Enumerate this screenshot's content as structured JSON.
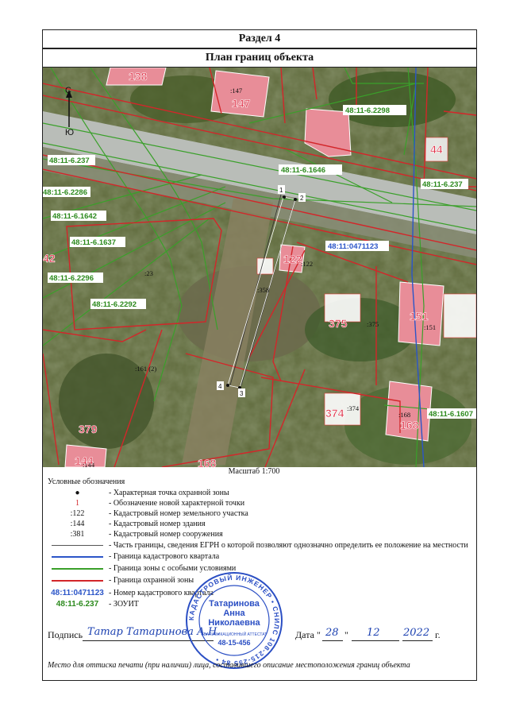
{
  "header": {
    "section": "Раздел 4",
    "title": "План границ объекта"
  },
  "map": {
    "compass_n": "С",
    "compass_s": "Ю",
    "zone_labels": [
      "48:11-6.2298",
      "48:11-6.237",
      "48:11-6.1646",
      "48:11-6.2286",
      "48:11-6.1642",
      "48:11-6.1637",
      "48:11-6.2296",
      "48:11-6.2292",
      "48:11-6.237",
      "48:11-6.1607"
    ],
    "quarter_label": "48:11:0471123",
    "parcel_labels": [
      ":147",
      ":122",
      ":23",
      ":358",
      ":375",
      ":151",
      ":161 (2)",
      ":374",
      ":168",
      ":379",
      ":144"
    ],
    "building_numbers": [
      "138",
      "147",
      "44",
      "122",
      "375",
      "151",
      "374",
      "168",
      "379",
      "144",
      "168",
      "42"
    ],
    "points": [
      "1",
      "2",
      "3",
      "4"
    ]
  },
  "scale": "Масштаб 1:700",
  "legend": {
    "title": "Условные обозначения",
    "items": [
      {
        "sym": "●",
        "text": "- Характерная точка охранной зоны"
      },
      {
        "sym": "1",
        "text": "- Обозначение новой характерной точки"
      },
      {
        "sym": ":122",
        "text": "- Кадастровый номер земельного участка"
      },
      {
        "sym": ":144",
        "text": "- Кадастровый номер здания"
      },
      {
        "sym": ":381",
        "text": "- Кадастровый номер сооружения"
      },
      {
        "sym": "",
        "text": "- Часть границы, сведения ЕГРН о которой позволяют однозначно определить ее положение на местности"
      },
      {
        "sym": "",
        "text": "- Граница кадастрового квартала"
      },
      {
        "sym": "",
        "text": "- Граница зоны с особыми условиями"
      },
      {
        "sym": "",
        "text": "- Граница охранной зоны"
      },
      {
        "sym": "48:11:0471123",
        "text": "- Номер кадастрового квартала"
      },
      {
        "sym": "48:11-6.237",
        "text": "- ЗОУИТ"
      }
    ]
  },
  "sign": {
    "label": "Подпись",
    "handwriting": "Татар Татаринова А.Н.",
    "date_label": "Дата",
    "day": "28",
    "month": "12",
    "year": "2022",
    "year_suffix": "г."
  },
  "stamp": {
    "ring_text": "КАДАСТРОВЫЙ ИНЖЕНЕР • СНИЛС 108-215-255 84 •",
    "name1": "Татаринова",
    "name2": "Анна",
    "name3": "Николаевна",
    "small": "КВАЛИФИКАЦИОННЫЙ АТТЕСТАТ",
    "number": "48-15-456"
  },
  "footer_note": "Место для оттиска печати (при наличии) лица, составившего описание местоположения границ объекта",
  "colors": {
    "blue": "#2b55c8",
    "green": "#3aa02a",
    "red": "#d3262a",
    "pink": "#e88d98"
  }
}
